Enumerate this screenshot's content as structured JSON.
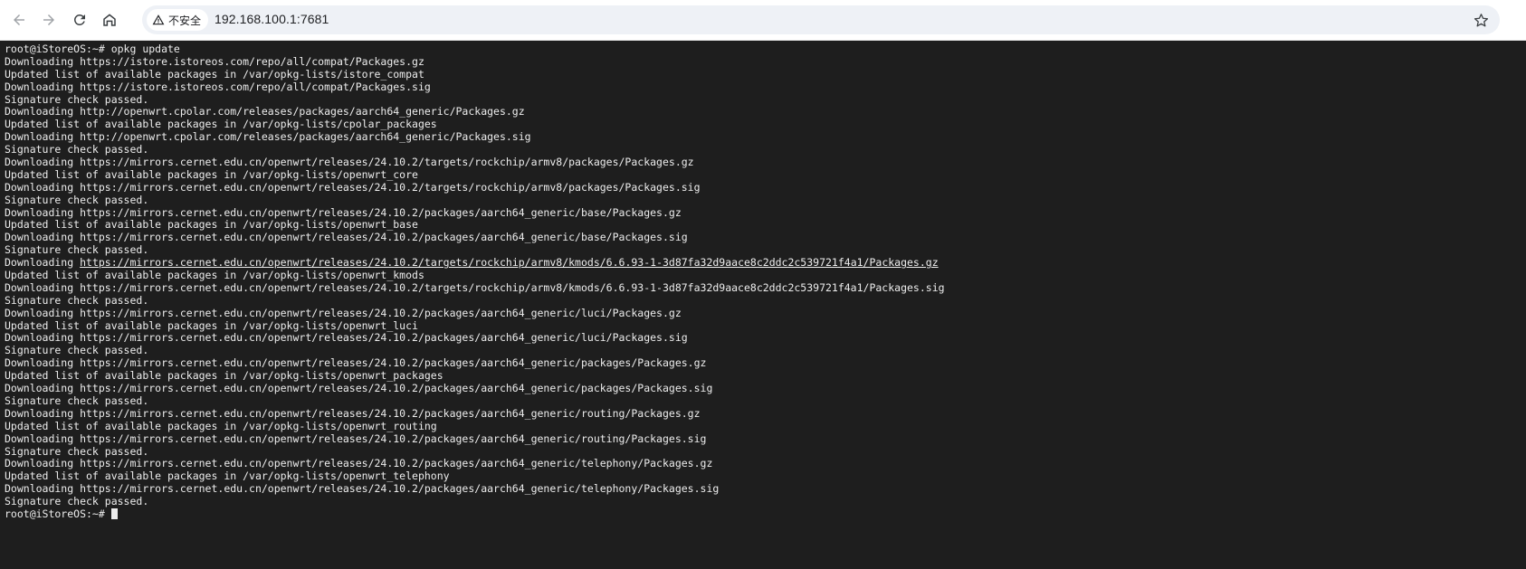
{
  "browser": {
    "back_icon": "arrow-left-icon",
    "forward_icon": "arrow-right-icon",
    "reload_icon": "reload-icon",
    "home_icon": "home-icon",
    "security_icon": "warning-triangle-icon",
    "security_label": "不安全",
    "url": "192.168.100.1:7681",
    "bookmark_icon": "star-icon",
    "toolbar_bg": "#ffffff",
    "omnibox_bg": "#eef1f6"
  },
  "terminal": {
    "bg": "#1e1e1e",
    "fg": "#ededed",
    "lines": [
      "root@iStoreOS:~# opkg update",
      "Downloading https://istore.istoreos.com/repo/all/compat/Packages.gz",
      "Updated list of available packages in /var/opkg-lists/istore_compat",
      "Downloading https://istore.istoreos.com/repo/all/compat/Packages.sig",
      "Signature check passed.",
      "Downloading http://openwrt.cpolar.com/releases/packages/aarch64_generic/Packages.gz",
      "Updated list of available packages in /var/opkg-lists/cpolar_packages",
      "Downloading http://openwrt.cpolar.com/releases/packages/aarch64_generic/Packages.sig",
      "Signature check passed.",
      "Downloading https://mirrors.cernet.edu.cn/openwrt/releases/24.10.2/targets/rockchip/armv8/packages/Packages.gz",
      "Updated list of available packages in /var/opkg-lists/openwrt_core",
      "Downloading https://mirrors.cernet.edu.cn/openwrt/releases/24.10.2/targets/rockchip/armv8/packages/Packages.sig",
      "Signature check passed.",
      "Downloading https://mirrors.cernet.edu.cn/openwrt/releases/24.10.2/packages/aarch64_generic/base/Packages.gz",
      "Updated list of available packages in /var/opkg-lists/openwrt_base",
      "Downloading https://mirrors.cernet.edu.cn/openwrt/releases/24.10.2/packages/aarch64_generic/base/Packages.sig",
      "Signature check passed.",
      "Downloading ",
      "Updated list of available packages in /var/opkg-lists/openwrt_kmods",
      "Downloading https://mirrors.cernet.edu.cn/openwrt/releases/24.10.2/targets/rockchip/armv8/kmods/6.6.93-1-3d87fa32d9aace8c2ddc2c539721f4a1/Packages.sig",
      "Signature check passed.",
      "Downloading https://mirrors.cernet.edu.cn/openwrt/releases/24.10.2/packages/aarch64_generic/luci/Packages.gz",
      "Updated list of available packages in /var/opkg-lists/openwrt_luci",
      "Downloading https://mirrors.cernet.edu.cn/openwrt/releases/24.10.2/packages/aarch64_generic/luci/Packages.sig",
      "Signature check passed.",
      "Downloading https://mirrors.cernet.edu.cn/openwrt/releases/24.10.2/packages/aarch64_generic/packages/Packages.gz",
      "Updated list of available packages in /var/opkg-lists/openwrt_packages",
      "Downloading https://mirrors.cernet.edu.cn/openwrt/releases/24.10.2/packages/aarch64_generic/packages/Packages.sig",
      "Signature check passed.",
      "Downloading https://mirrors.cernet.edu.cn/openwrt/releases/24.10.2/packages/aarch64_generic/routing/Packages.gz",
      "Updated list of available packages in /var/opkg-lists/openwrt_routing",
      "Downloading https://mirrors.cernet.edu.cn/openwrt/releases/24.10.2/packages/aarch64_generic/routing/Packages.sig",
      "Signature check passed.",
      "Downloading https://mirrors.cernet.edu.cn/openwrt/releases/24.10.2/packages/aarch64_generic/telephony/Packages.gz",
      "Updated list of available packages in /var/opkg-lists/openwrt_telephony",
      "Downloading https://mirrors.cernet.edu.cn/openwrt/releases/24.10.2/packages/aarch64_generic/telephony/Packages.sig",
      "Signature check passed."
    ],
    "hovered_link": "https://mirrors.cernet.edu.cn/openwrt/releases/24.10.2/targets/rockchip/armv8/kmods/6.6.93-1-3d87fa32d9aace8c2ddc2c539721f4a1/Packages.gz",
    "prompt": "root@iStoreOS:~# "
  }
}
